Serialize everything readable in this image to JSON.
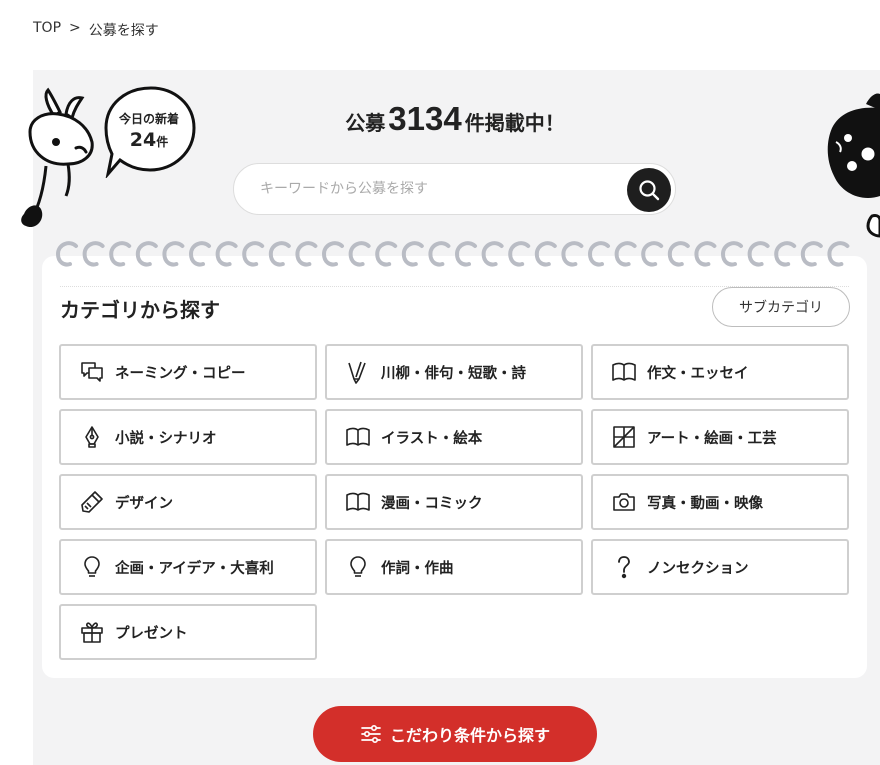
{
  "breadcrumb": {
    "home": "TOP",
    "separator": ">",
    "current": "公募を探す"
  },
  "bubble": {
    "title": "今日の新着",
    "count": "24",
    "unit": "件"
  },
  "headline": {
    "prefix": "公募",
    "count": "3134",
    "suffix": "件掲載中！"
  },
  "search": {
    "placeholder": "キーワードから公募を探す",
    "icon": "search-icon"
  },
  "categories": {
    "title": "カテゴリから探す",
    "subcategory_button": "サブカテゴリ",
    "items": [
      {
        "label": "ネーミング・コピー",
        "icon": "speech-bubbles-icon"
      },
      {
        "label": "川柳・俳句・短歌・詩",
        "icon": "brush-icon"
      },
      {
        "label": "作文・エッセイ",
        "icon": "book-icon"
      },
      {
        "label": "小説・シナリオ",
        "icon": "pen-nib-icon"
      },
      {
        "label": "イラスト・絵本",
        "icon": "book-icon"
      },
      {
        "label": "アート・絵画・工芸",
        "icon": "art-frame-icon"
      },
      {
        "label": "デザイン",
        "icon": "paint-tube-icon"
      },
      {
        "label": "漫画・コミック",
        "icon": "book-icon"
      },
      {
        "label": "写真・動画・映像",
        "icon": "camera-icon"
      },
      {
        "label": "企画・アイデア・大喜利",
        "icon": "lightbulb-icon"
      },
      {
        "label": "作詞・作曲",
        "icon": "lightbulb-icon"
      },
      {
        "label": "ノンセクション",
        "icon": "question-icon"
      },
      {
        "label": "プレゼント",
        "icon": "gift-icon"
      }
    ]
  },
  "cta": {
    "label": "こだわり条件から探す",
    "icon": "sliders-icon"
  },
  "colors": {
    "accent": "#d32f2a",
    "panel": "#f3f3f4",
    "dark": "#1e1e1e"
  }
}
